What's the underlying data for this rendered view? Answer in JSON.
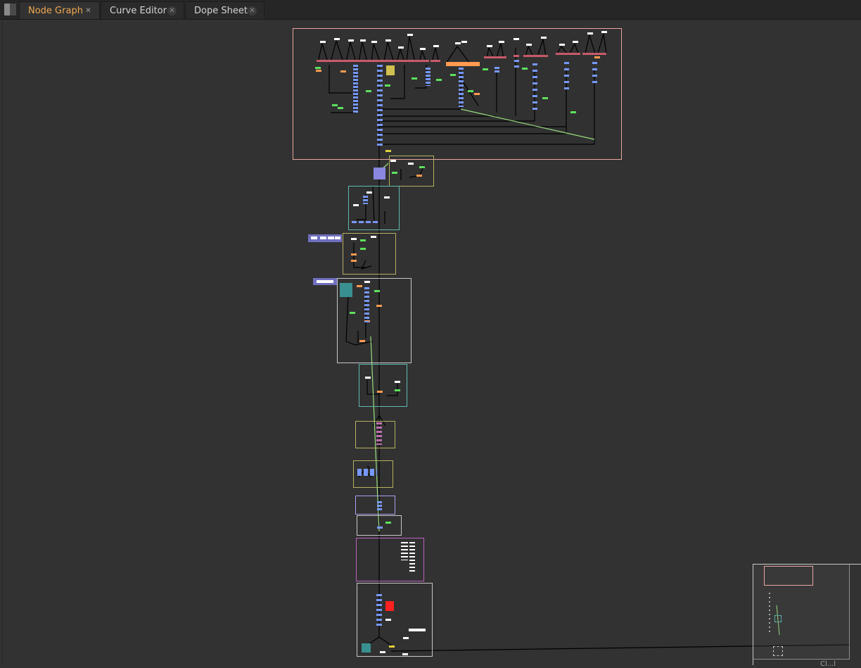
{
  "tabs": [
    {
      "label": "Node Graph",
      "active": true
    },
    {
      "label": "Curve Editor",
      "active": false
    },
    {
      "label": "Dope Sheet",
      "active": false
    }
  ],
  "close_glyph": "✕",
  "colors": {
    "background": "#323232",
    "tab_active_text": "#f0a850",
    "wire": "#000000",
    "expression_link": "#9be27f",
    "merge_node": "#ff5555",
    "grade_node": "#7799ff",
    "transform_node": "#88ee88",
    "roto_node": "#ffaa66",
    "read_node": "#ffffff",
    "backdrop_pink": "#e8a6a0",
    "backdrop_yellow": "#b6b060",
    "backdrop_cyan": "#5fb8b0",
    "backdrop_white": "#c8c8c8",
    "backdrop_lavender": "#a8a0f0",
    "backdrop_magenta": "#c060c0"
  },
  "minimap": {
    "label": "Cl...l"
  }
}
